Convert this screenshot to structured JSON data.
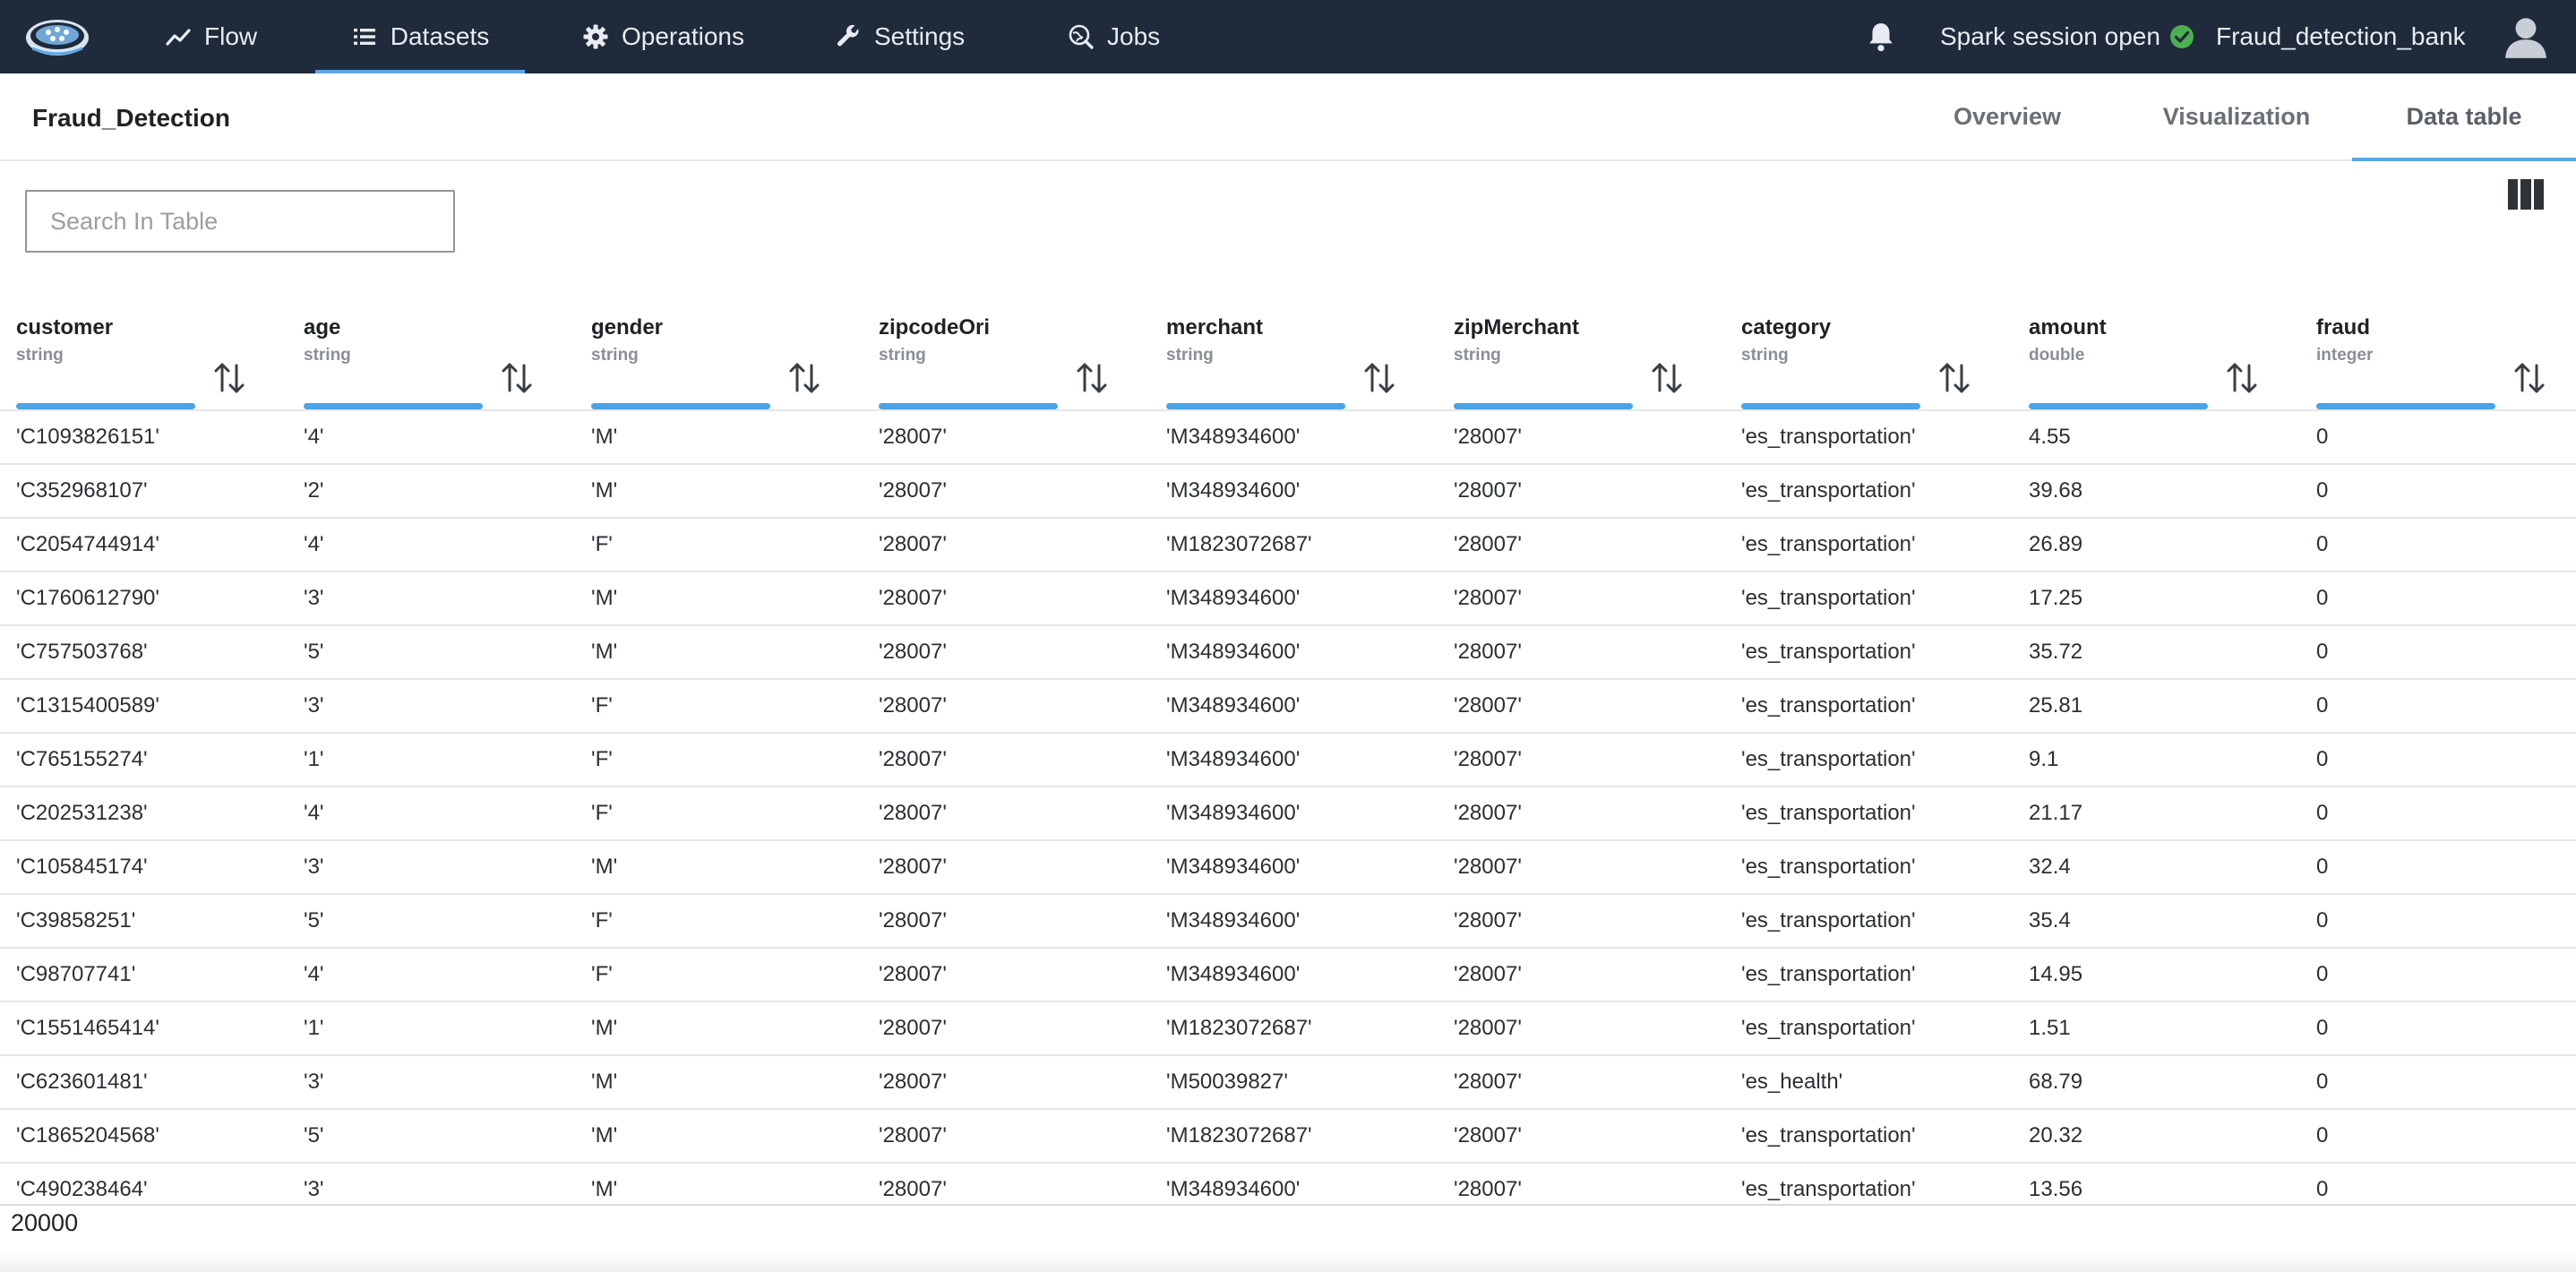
{
  "nav": {
    "items": [
      {
        "label": "Flow",
        "icon": "trend-line-icon"
      },
      {
        "label": "Datasets",
        "icon": "list-icon",
        "active": true
      },
      {
        "label": "Operations",
        "icon": "gear-icon"
      },
      {
        "label": "Settings",
        "icon": "wrench-icon"
      },
      {
        "label": "Jobs",
        "icon": "globe-search-icon"
      }
    ],
    "session_status": "Spark session open",
    "project_name": "Fraud_detection_bank"
  },
  "dataset": {
    "title": "Fraud_Detection",
    "tabs": [
      "Overview",
      "Visualization",
      "Data table"
    ],
    "active_tab": "Data table"
  },
  "search": {
    "placeholder": "Search In Table",
    "value": ""
  },
  "table": {
    "columns": [
      {
        "name": "customer",
        "type": "string"
      },
      {
        "name": "age",
        "type": "string"
      },
      {
        "name": "gender",
        "type": "string"
      },
      {
        "name": "zipcodeOri",
        "type": "string"
      },
      {
        "name": "merchant",
        "type": "string"
      },
      {
        "name": "zipMerchant",
        "type": "string"
      },
      {
        "name": "category",
        "type": "string"
      },
      {
        "name": "amount",
        "type": "double"
      },
      {
        "name": "fraud",
        "type": "integer"
      }
    ],
    "rows": [
      [
        "'C1093826151'",
        "'4'",
        "'M'",
        "'28007'",
        "'M348934600'",
        "'28007'",
        "'es_transportation'",
        "4.55",
        "0"
      ],
      [
        "'C352968107'",
        "'2'",
        "'M'",
        "'28007'",
        "'M348934600'",
        "'28007'",
        "'es_transportation'",
        "39.68",
        "0"
      ],
      [
        "'C2054744914'",
        "'4'",
        "'F'",
        "'28007'",
        "'M1823072687'",
        "'28007'",
        "'es_transportation'",
        "26.89",
        "0"
      ],
      [
        "'C1760612790'",
        "'3'",
        "'M'",
        "'28007'",
        "'M348934600'",
        "'28007'",
        "'es_transportation'",
        "17.25",
        "0"
      ],
      [
        "'C757503768'",
        "'5'",
        "'M'",
        "'28007'",
        "'M348934600'",
        "'28007'",
        "'es_transportation'",
        "35.72",
        "0"
      ],
      [
        "'C1315400589'",
        "'3'",
        "'F'",
        "'28007'",
        "'M348934600'",
        "'28007'",
        "'es_transportation'",
        "25.81",
        "0"
      ],
      [
        "'C765155274'",
        "'1'",
        "'F'",
        "'28007'",
        "'M348934600'",
        "'28007'",
        "'es_transportation'",
        "9.1",
        "0"
      ],
      [
        "'C202531238'",
        "'4'",
        "'F'",
        "'28007'",
        "'M348934600'",
        "'28007'",
        "'es_transportation'",
        "21.17",
        "0"
      ],
      [
        "'C105845174'",
        "'3'",
        "'M'",
        "'28007'",
        "'M348934600'",
        "'28007'",
        "'es_transportation'",
        "32.4",
        "0"
      ],
      [
        "'C39858251'",
        "'5'",
        "'F'",
        "'28007'",
        "'M348934600'",
        "'28007'",
        "'es_transportation'",
        "35.4",
        "0"
      ],
      [
        "'C98707741'",
        "'4'",
        "'F'",
        "'28007'",
        "'M348934600'",
        "'28007'",
        "'es_transportation'",
        "14.95",
        "0"
      ],
      [
        "'C1551465414'",
        "'1'",
        "'M'",
        "'28007'",
        "'M1823072687'",
        "'28007'",
        "'es_transportation'",
        "1.51",
        "0"
      ],
      [
        "'C623601481'",
        "'3'",
        "'M'",
        "'28007'",
        "'M50039827'",
        "'28007'",
        "'es_health'",
        "68.79",
        "0"
      ],
      [
        "'C1865204568'",
        "'5'",
        "'M'",
        "'28007'",
        "'M1823072687'",
        "'28007'",
        "'es_transportation'",
        "20.32",
        "0"
      ],
      [
        "'C490238464'",
        "'3'",
        "'M'",
        "'28007'",
        "'M348934600'",
        "'28007'",
        "'es_transportation'",
        "13.56",
        "0"
      ]
    ],
    "total_count": "20000"
  },
  "colors": {
    "topbar_bg": "#1f2a3a",
    "accent": "#4aa3e4",
    "success": "#4caf50"
  }
}
